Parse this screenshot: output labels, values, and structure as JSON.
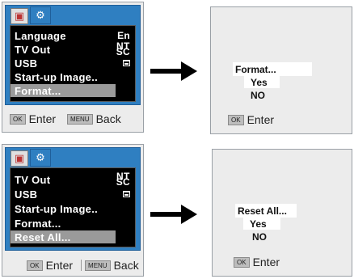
{
  "panel1": {
    "tab_camera_icon": "camera-icon",
    "tab_settings_icon": "wrench-icon",
    "items": [
      {
        "label": "Language",
        "value": "En"
      },
      {
        "label": "TV Out",
        "value_top": "NT",
        "value_bottom": "SC"
      },
      {
        "label": "USB",
        "value_icon": "printer-icon"
      },
      {
        "label": "Start-up Image.."
      },
      {
        "label": "Format..."
      }
    ],
    "selected_index": 4,
    "footer": {
      "ok_key": "OK",
      "ok_label": "Enter",
      "menu_key": "MENU",
      "menu_label": "Back"
    }
  },
  "panel2": {
    "title": "Format...",
    "options": [
      "Yes",
      "NO"
    ],
    "selected_option": 0,
    "footer": {
      "ok_key": "OK",
      "ok_label": "Enter"
    }
  },
  "panel3": {
    "tab_camera_icon": "camera-icon",
    "tab_settings_icon": "wrench-icon",
    "items": [
      {
        "label": "TV Out",
        "value_top": "NT",
        "value_bottom": "SC"
      },
      {
        "label": "USB",
        "value_icon": "printer-icon"
      },
      {
        "label": "Start-up Image.."
      },
      {
        "label": "Format..."
      },
      {
        "label": "Reset All..."
      }
    ],
    "selected_index": 4,
    "footer": {
      "ok_key": "OK",
      "ok_label": "Enter",
      "menu_key": "MENU",
      "menu_label": "Back"
    }
  },
  "panel4": {
    "title": "Reset All...",
    "options": [
      "Yes",
      "NO"
    ],
    "selected_option": 0,
    "footer": {
      "ok_key": "OK",
      "ok_label": "Enter"
    }
  },
  "colors": {
    "accent": "#2f7fc1",
    "screen_bg": "#000000",
    "selection": "#9a9a9a",
    "panel_bg": "#ececec"
  }
}
